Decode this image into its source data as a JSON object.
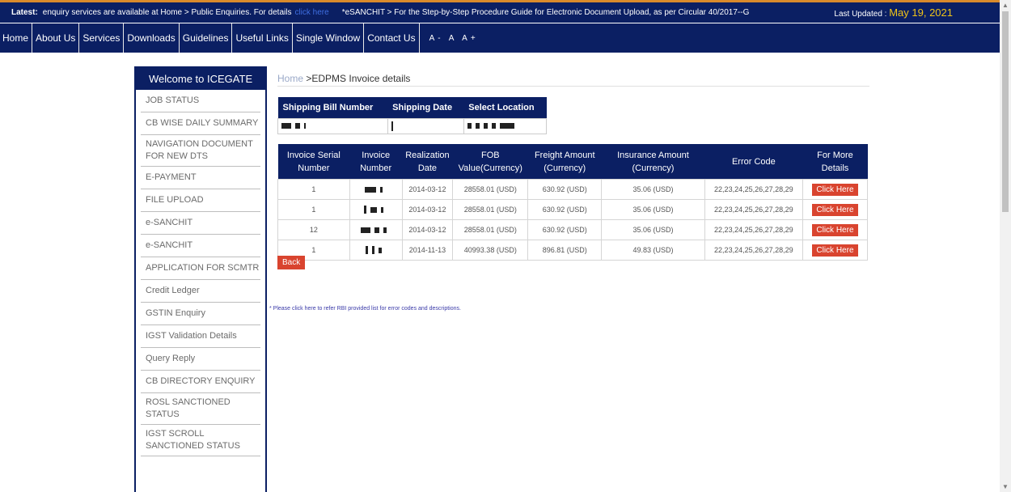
{
  "ticker": {
    "latest_label": "Latest:",
    "message": "enquiry services are available at Home > Public Enquiries. For details",
    "message_link": "click here",
    "message2": "*eSANCHIT > For the Step-by-Step Procedure Guide for Electronic Document Upload, as per Circular 40/2017--G",
    "last_updated_label": "Last Updated :",
    "last_updated_date": "May 19, 2021"
  },
  "nav": {
    "items": [
      "Home",
      "About Us",
      "Services",
      "Downloads",
      "Guidelines",
      "Useful Links",
      "Single Window",
      "Contact Us"
    ],
    "font_size_controls": "A- A A+"
  },
  "sidebar": {
    "title": "Welcome to ICEGATE",
    "items": [
      "JOB STATUS",
      "CB WISE DAILY SUMMARY",
      "NAVIGATION DOCUMENT FOR NEW DTS",
      "E-PAYMENT",
      "FILE UPLOAD",
      "e-SANCHIT",
      "e-SANCHIT",
      "APPLICATION FOR SCMTR",
      "Credit Ledger",
      "GSTIN Enquiry",
      "IGST Validation Details",
      "Query Reply",
      "CB DIRECTORY ENQUIRY",
      "ROSL SANCTIONED STATUS",
      "IGST SCROLL SANCTIONED STATUS"
    ]
  },
  "breadcrumb": {
    "home": "Home",
    "current": ">EDPMS Invoice details"
  },
  "shipping": {
    "headers": [
      "Shipping Bill Number",
      "Shipping Date",
      "Select Location"
    ]
  },
  "invoices": {
    "headers": [
      "Invoice Serial Number",
      "Invoice Number",
      "Realization Date",
      "FOB Value(Currency)",
      "Freight Amount (Currency)",
      "Insurance Amount (Currency)",
      "Error Code",
      "For More Details"
    ],
    "rows": [
      {
        "serial": "1",
        "date": "2014-03-12",
        "fob": "28558.01 (USD)",
        "freight": "630.92 (USD)",
        "insurance": "35.06 (USD)",
        "error": "22,23,24,25,26,27,28,29",
        "action": "Click Here"
      },
      {
        "serial": "1",
        "date": "2014-03-12",
        "fob": "28558.01 (USD)",
        "freight": "630.92 (USD)",
        "insurance": "35.06 (USD)",
        "error": "22,23,24,25,26,27,28,29",
        "action": "Click Here"
      },
      {
        "serial": "12",
        "date": "2014-03-12",
        "fob": "28558.01 (USD)",
        "freight": "630.92 (USD)",
        "insurance": "35.06 (USD)",
        "error": "22,23,24,25,26,27,28,29",
        "action": "Click Here"
      },
      {
        "serial": "1",
        "date": "2014-11-13",
        "fob": "40993.38 (USD)",
        "freight": "896.81 (USD)",
        "insurance": "49.83 (USD)",
        "error": "22,23,24,25,26,27,28,29",
        "action": "Click Here"
      }
    ]
  },
  "back_label": "Back",
  "note": "* Please click here to refer RBI provided list for error codes and descriptions."
}
